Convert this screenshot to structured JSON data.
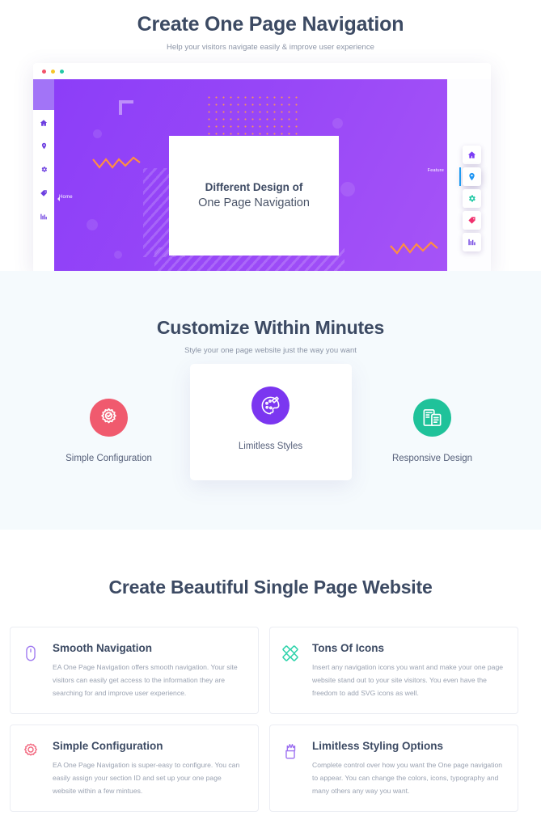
{
  "hero": {
    "title": "Create One Page Navigation",
    "subtitle": "Help your visitors navigate easily & improve user experience",
    "browser": {
      "dots": [
        "red",
        "yellow",
        "green"
      ],
      "card_line1": "Different Design of",
      "card_line2": "One Page Navigation",
      "left_nav_tooltip": "Home",
      "right_nav_label": "Feature",
      "left_nav_icons": [
        "home-icon",
        "location-pin-icon",
        "gear-icon",
        "tag-icon",
        "chart-icon"
      ],
      "right_nav_icons": [
        "home-icon",
        "location-pin-icon",
        "gear-icon",
        "tag-icon",
        "chart-icon"
      ]
    },
    "colors": {
      "gradient_start": "#8b3df8",
      "gradient_end": "#a855f7",
      "accent_orange": "#ff9a4d"
    }
  },
  "middle": {
    "title": "Customize Within Minutes",
    "subtitle": "Style your one page website just the way you want",
    "background": "#f5fafd",
    "features": [
      {
        "label": "Simple Configuration",
        "icon": "gear-check-icon",
        "color": "#f05a6e",
        "raised": false
      },
      {
        "label": "Limitless Styles",
        "icon": "palette-icon",
        "color": "#7b36f0",
        "raised": true
      },
      {
        "label": "Responsive Design",
        "icon": "responsive-devices-icon",
        "color": "#1fc29a",
        "raised": false
      }
    ],
    "float_nav": [
      {
        "icon": "home-icon",
        "color": "#7b3df5"
      },
      {
        "icon": "badge-star-icon",
        "color": "#3b6fd4"
      },
      {
        "icon": "gear-icon",
        "color": "#2bb783"
      },
      {
        "icon": "dollar-badge-icon",
        "color": "#cc3b8e"
      },
      {
        "icon": "document-edit-icon",
        "color": "#7b3df5"
      }
    ]
  },
  "bottom": {
    "title": "Create Beautiful Single Page Website",
    "cards": [
      {
        "icon": "mouse-icon",
        "icon_color": "#a07af0",
        "title": "Smooth Navigation",
        "desc": "EA One Page Navigation offers smooth navigation. Your site visitors can easily get access to the information they are searching for and improve user experience."
      },
      {
        "icon": "four-diamonds-icon",
        "icon_color": "#2ed3ab",
        "title": "Tons Of Icons",
        "desc": "Insert any navigation icons you want and make your one page website stand out to your site visitors. You even have the freedom to add SVG icons as well."
      },
      {
        "icon": "gear-outline-icon",
        "icon_color": "#f2627a",
        "title": "Simple Configuration",
        "desc": "EA One Page Navigation is super-easy to configure. You can easily assign your section ID and set up your one page website within a few mintues."
      },
      {
        "icon": "brush-cup-icon",
        "icon_color": "#9b6ef0",
        "title": "Limitless Styling Options",
        "desc": "Complete control over how you want the One page navigation to appear. You can change the colors, icons, typography and many others any way you want."
      }
    ]
  }
}
